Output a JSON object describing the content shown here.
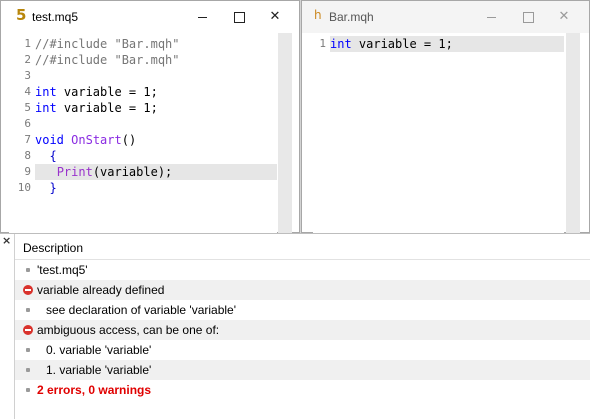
{
  "windows": [
    {
      "icon_glyph": "5",
      "title": "test.mq5",
      "lines": [
        "1",
        "2",
        "3",
        "4",
        "5",
        "6",
        "7",
        "8",
        "9",
        "10"
      ],
      "code": {
        "l1_comment": "//#include \"Bar.mqh\"",
        "l2_comment": "//#include \"Bar.mqh\"",
        "l4_kw": "int",
        "l4_rest": " variable = 1;",
        "l5_kw": "int",
        "l5_rest": " variable = 1;",
        "l7_kw": "void",
        "l7_fn": "OnStart",
        "l7_paren": "()",
        "l8_brace": "{",
        "l9_fn": "Print",
        "l9_rest": "(variable);",
        "l10_brace": "}"
      }
    },
    {
      "icon_glyph": "h",
      "title": "Bar.mqh",
      "lines": [
        "1"
      ],
      "code": {
        "l1_kw": "int",
        "l1_rest": " variable = 1;"
      }
    }
  ],
  "controls": {
    "close_glyph": "✕"
  },
  "errors_panel": {
    "close_glyph": "×",
    "column_header": "Description",
    "rows": [
      {
        "type": "info",
        "text": "'test.mq5'"
      },
      {
        "type": "error",
        "text": "variable already defined"
      },
      {
        "type": "info",
        "text": "see declaration of variable 'variable'"
      },
      {
        "type": "error",
        "text": "ambiguous access, can be one of:"
      },
      {
        "type": "info",
        "text": "0. variable 'variable'"
      },
      {
        "type": "info",
        "text": "1. variable 'variable'"
      },
      {
        "type": "summary",
        "text": "2 errors, 0 warnings"
      }
    ]
  },
  "colors": {
    "error_red": "#e00000",
    "error_icon": "#d9322c",
    "keyword_blue": "#0000ff",
    "function_purple": "#8a2be2",
    "comment_gray": "#767676"
  }
}
